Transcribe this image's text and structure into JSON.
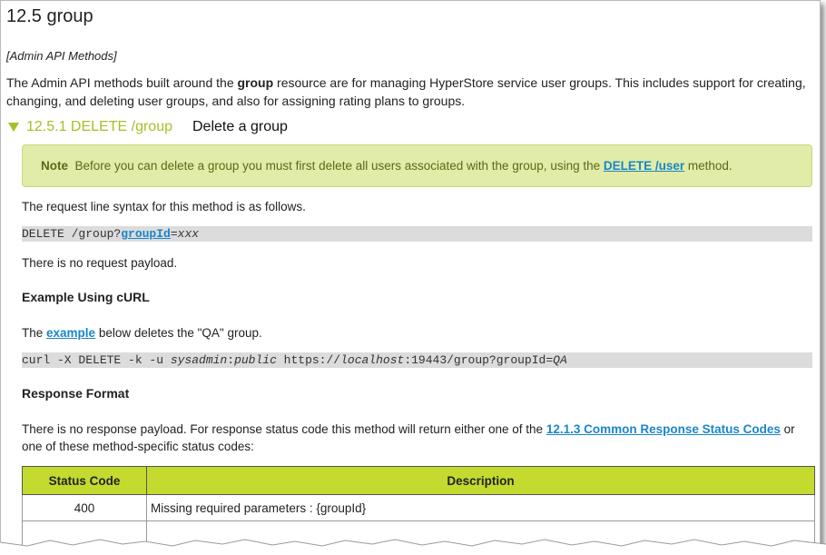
{
  "heading": "12.5 group",
  "subtitle": "[Admin API Methods]",
  "intro": {
    "pre": "The Admin API methods built around the ",
    "bold": "group",
    "post": " resource are for managing HyperStore service user groups. This includes support for creating, changing, and deleting user groups, and also for assigning rating plans to groups."
  },
  "section": {
    "number": "12.5.1 DELETE /group",
    "title": "Delete a group"
  },
  "note": {
    "label": "Note",
    "pre": "Before you can delete a group you must first delete all users associated with the group, using the ",
    "link": "DELETE /user",
    "post": " method."
  },
  "syntax_intro": "The request line syntax for this method is as follows.",
  "syntax_code": {
    "pre": "DELETE /group?",
    "param": "groupId",
    "eq": "=",
    "val": "xxx"
  },
  "no_payload": "There is no request payload.",
  "example_heading": "Example Using cURL",
  "example_text": {
    "pre": "The ",
    "link": "example",
    "post": " below deletes the \"QA\" group."
  },
  "curl_code": {
    "p1": "curl -X DELETE -k -u ",
    "i1": "sysadmin",
    "p2": ":",
    "i2": "public",
    "p3": " https://",
    "i3": "localhost",
    "p4": ":19443/group?groupId=",
    "i4": "QA"
  },
  "response_heading": "Response Format",
  "response_text": {
    "pre": "There is no response payload. For response status code this method will return either one of the ",
    "link": "12.1.3 Common Response Status Codes",
    "post": " or one of these method-specific status codes:"
  },
  "table": {
    "headers": [
      "Status Code",
      "Description"
    ],
    "rows": [
      {
        "code": "400",
        "desc": "Missing required parameters : {groupId}"
      }
    ]
  },
  "colors": {
    "accent": "#a7bf26",
    "header_bg": "#c4da2e",
    "note_bg": "#e0eca8",
    "link": "#1a86c9"
  }
}
